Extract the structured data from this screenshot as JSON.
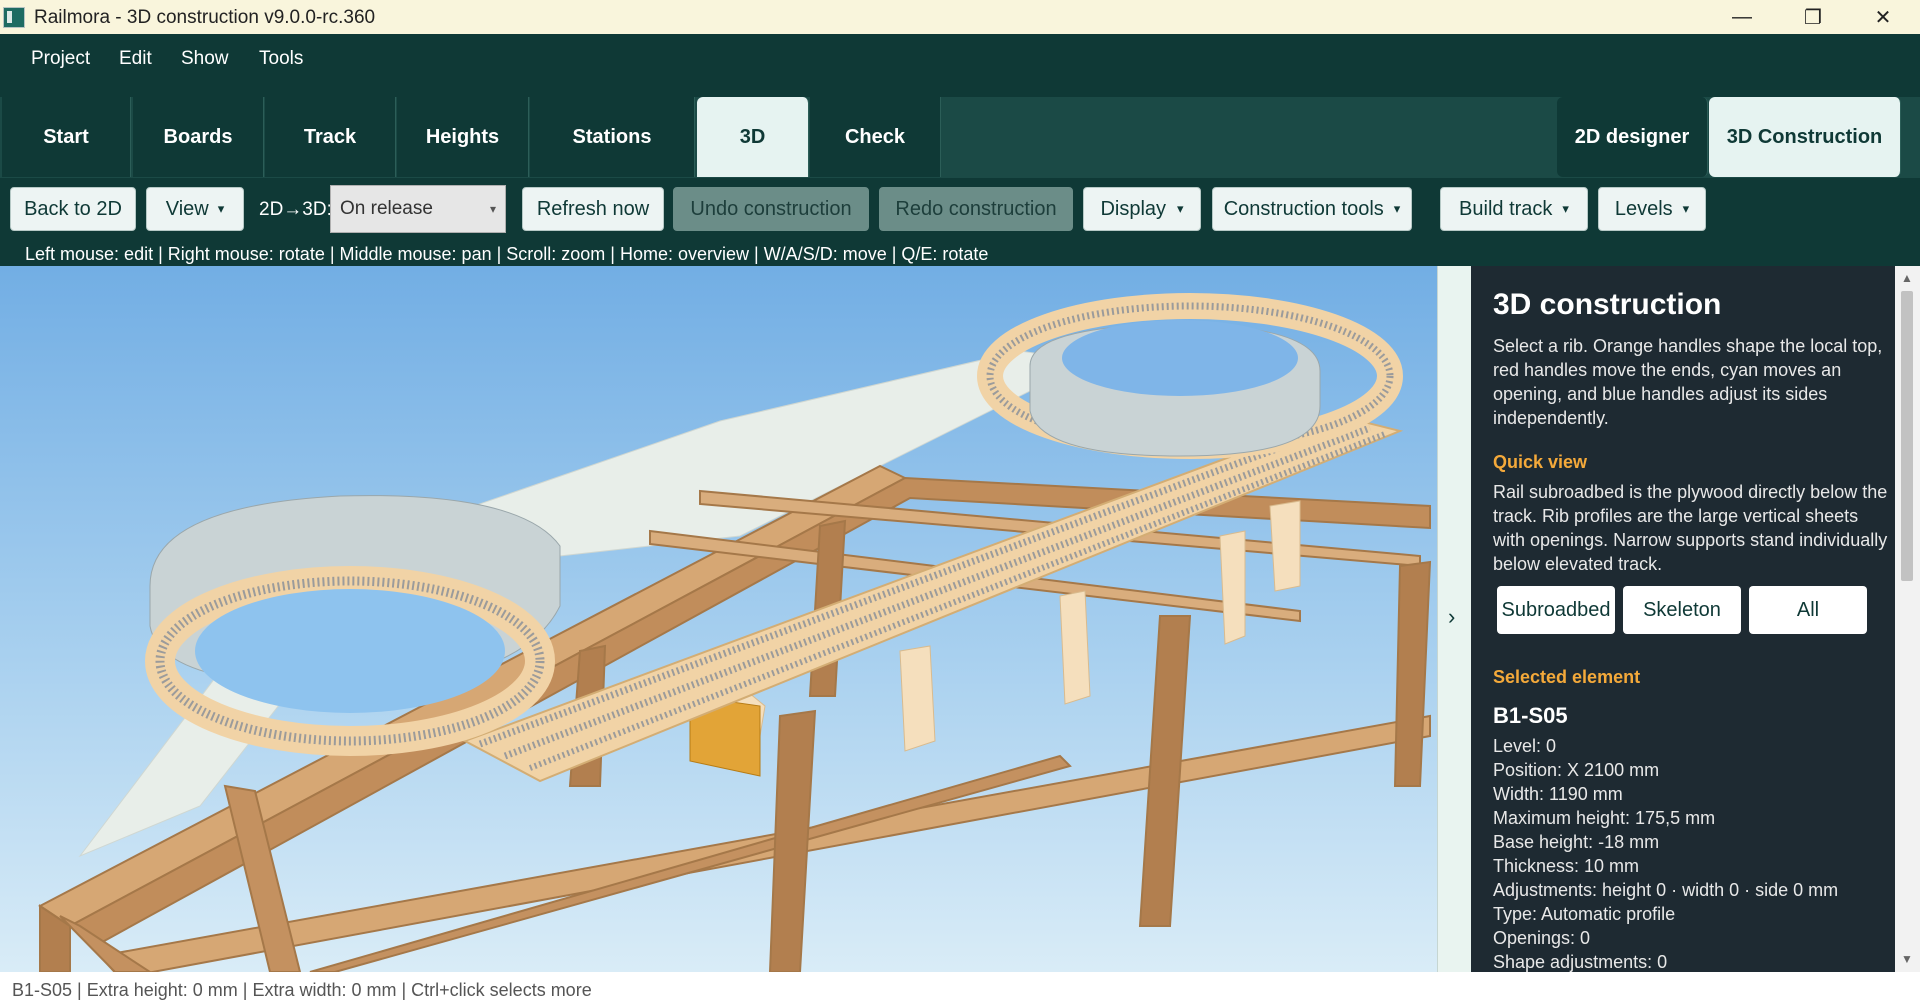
{
  "window": {
    "title": "Railmora - 3D construction v9.0.0-rc.360",
    "minimize": "—",
    "maximize": "❐",
    "close": "✕"
  },
  "menu": [
    "Project",
    "Edit",
    "Show",
    "Tools"
  ],
  "tabs": {
    "items": [
      "Start",
      "Boards",
      "Track",
      "Heights",
      "Stations",
      "3D",
      "Check"
    ],
    "active": "3D",
    "modes": [
      "2D designer",
      "3D Construction"
    ],
    "active_mode": "3D Construction"
  },
  "toolbar": {
    "back": "Back to 2D",
    "view": "View",
    "mode_label": "2D→3D:",
    "mode_value": "On release",
    "refresh": "Refresh now",
    "undo": "Undo construction",
    "redo": "Redo construction",
    "display": "Display",
    "construction_tools": "Construction tools",
    "build_track": "Build track",
    "levels": "Levels",
    "dropdown_arrow": "▾",
    "hint": "Left mouse: edit | Right mouse: rotate | Middle mouse: pan | Scroll: zoom | Home: overview | W/A/S/D: move | Q/E: rotate"
  },
  "viewport": {
    "collapse_icon": "›"
  },
  "panel": {
    "title": "3D construction",
    "intro": "Select a rib. Orange handles shape the local top, red handles move the ends, cyan moves an opening, and blue handles adjust its sides independently.",
    "quick_view_heading": "Quick view",
    "quick_view_text": "Rail subroadbed is the plywood directly below the track. Rib profiles are the large vertical sheets with openings. Narrow supports stand individually below elevated track.",
    "buttons": [
      "Subroadbed",
      "Skeleton",
      "All"
    ],
    "selected_heading": "Selected element",
    "selected_name": "B1-S05",
    "details": [
      "Level: 0",
      "Position: X 2100 mm",
      "Width: 1190 mm",
      "Maximum height: 175,5 mm",
      "Base height: -18 mm",
      "Thickness: 10 mm",
      "Adjustments: height 0 · width 0 · side 0 mm",
      "Type: Automatic profile",
      "Openings: 0",
      "Shape adjustments: 0"
    ]
  },
  "status": "B1-S05 | Extra height: 0 mm | Extra width: 0 mm | Ctrl+click selects more"
}
